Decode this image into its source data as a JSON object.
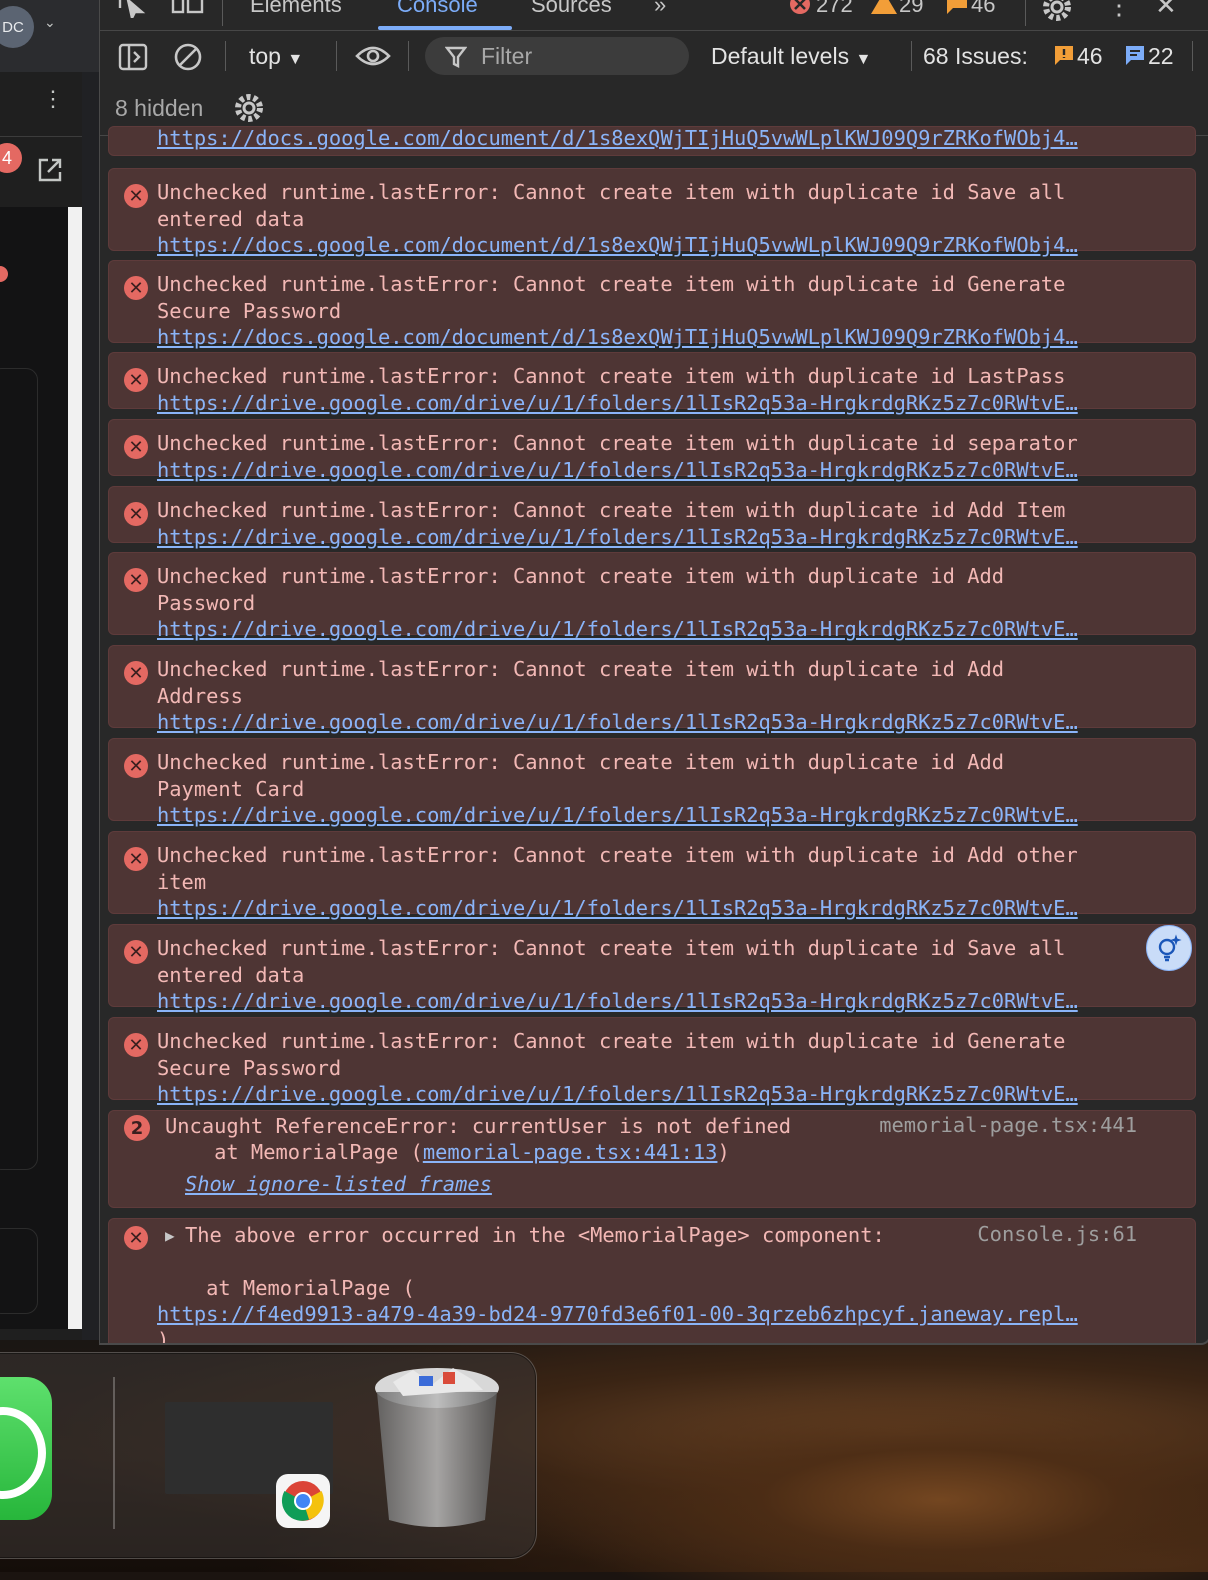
{
  "devtools": {
    "tabs": [
      "Elements",
      "Console",
      "Sources"
    ],
    "more_tabs": "»",
    "counts": {
      "errors": "272",
      "warnings": "29",
      "issues": "46"
    },
    "toolbar": {
      "context": "top",
      "filter_placeholder": "Filter",
      "levels": "Default levels",
      "issues_label": "68 Issues:",
      "issues_warn": "46",
      "issues_info": "22",
      "hidden": "8 hidden"
    }
  },
  "left_panel": {
    "avatar": "DC",
    "badge": "4"
  },
  "messages": [
    {
      "lines": [],
      "link": "https://docs.google.com/document/d/1s8exQWjTIjHuQ5vwWLplKWJ09Q9rZRKofWObj4…"
    },
    {
      "lines": [
        "Unchecked runtime.lastError: Cannot create item with duplicate id Save all",
        "entered data"
      ],
      "link": "https://docs.google.com/document/d/1s8exQWjTIjHuQ5vwWLplKWJ09Q9rZRKofWObj4…"
    },
    {
      "lines": [
        "Unchecked runtime.lastError: Cannot create item with duplicate id Generate",
        "Secure Password"
      ],
      "link": "https://docs.google.com/document/d/1s8exQWjTIjHuQ5vwWLplKWJ09Q9rZRKofWObj4…"
    },
    {
      "lines": [
        "Unchecked runtime.lastError: Cannot create item with duplicate id LastPass"
      ],
      "link": "https://drive.google.com/drive/u/1/folders/1lIsR2q53a-HrgkrdgRKz5z7c0RWtvE…"
    },
    {
      "lines": [
        "Unchecked runtime.lastError: Cannot create item with duplicate id separator"
      ],
      "link": "https://drive.google.com/drive/u/1/folders/1lIsR2q53a-HrgkrdgRKz5z7c0RWtvE…"
    },
    {
      "lines": [
        "Unchecked runtime.lastError: Cannot create item with duplicate id Add Item"
      ],
      "link": "https://drive.google.com/drive/u/1/folders/1lIsR2q53a-HrgkrdgRKz5z7c0RWtvE…"
    },
    {
      "lines": [
        "Unchecked runtime.lastError: Cannot create item with duplicate id Add",
        "Password"
      ],
      "link": "https://drive.google.com/drive/u/1/folders/1lIsR2q53a-HrgkrdgRKz5z7c0RWtvE…"
    },
    {
      "lines": [
        "Unchecked runtime.lastError: Cannot create item with duplicate id Add",
        "Address"
      ],
      "link": "https://drive.google.com/drive/u/1/folders/1lIsR2q53a-HrgkrdgRKz5z7c0RWtvE…"
    },
    {
      "lines": [
        "Unchecked runtime.lastError: Cannot create item with duplicate id Add",
        "Payment Card"
      ],
      "link": "https://drive.google.com/drive/u/1/folders/1lIsR2q53a-HrgkrdgRKz5z7c0RWtvE…"
    },
    {
      "lines": [
        "Unchecked runtime.lastError: Cannot create item with duplicate id Add other",
        "item"
      ],
      "link": "https://drive.google.com/drive/u/1/folders/1lIsR2q53a-HrgkrdgRKz5z7c0RWtvE…"
    },
    {
      "lines": [
        "Unchecked runtime.lastError: Cannot create item with duplicate id Save all",
        "entered data"
      ],
      "link": "https://drive.google.com/drive/u/1/folders/1lIsR2q53a-HrgkrdgRKz5z7c0RWtvE…"
    },
    {
      "lines": [
        "Unchecked runtime.lastError: Cannot create item with duplicate id Generate",
        "Secure Password"
      ],
      "link": "https://drive.google.com/drive/u/1/folders/1lIsR2q53a-HrgkrdgRKz5z7c0RWtvE…"
    }
  ],
  "reference_error": {
    "count": "2",
    "message": "Uncaught ReferenceError: currentUser is not defined",
    "source": "memorial-page.tsx:441",
    "stack_prefix": "    at MemorialPage (",
    "stack_link": "memorial-page.tsx:441:13",
    "stack_suffix": ")",
    "show_frames": "Show ignore-listed frames"
  },
  "component_error": {
    "message": "The above error occurred in the <MemorialPage> component:",
    "source": "Console.js:61",
    "stack": "    at MemorialPage (",
    "link": "https://f4ed9913-a479-4a39-bd24-9770fd3e6f01-00-3qrzeb6zhpcyf.janeway.repl…",
    "close": ")"
  }
}
